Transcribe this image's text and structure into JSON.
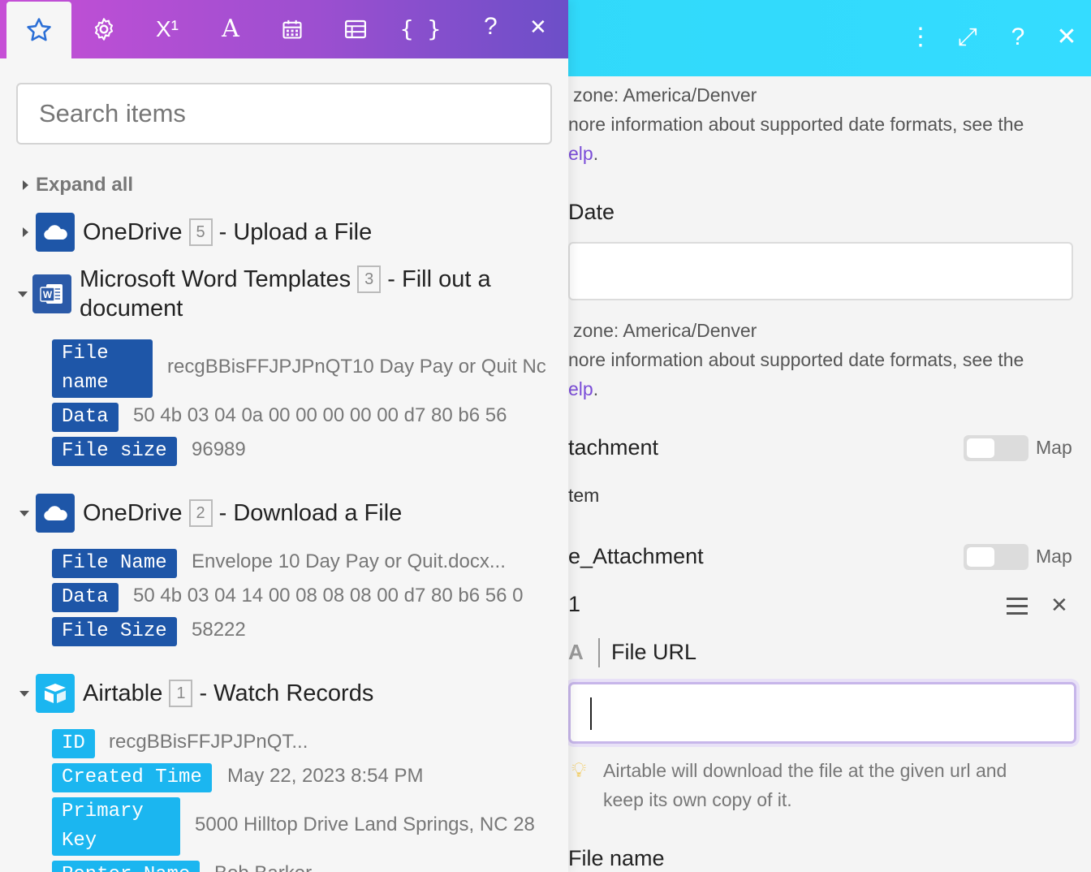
{
  "left_panel": {
    "tabs": [
      {
        "name": "star-icon",
        "glyph": "☆"
      },
      {
        "name": "gear-icon",
        "glyph": "⚙"
      },
      {
        "name": "superscript-icon",
        "glyph": "X¹"
      },
      {
        "name": "text-icon",
        "glyph": "A"
      },
      {
        "name": "calendar-icon",
        "glyph": "▦"
      },
      {
        "name": "table-icon",
        "glyph": "▤"
      },
      {
        "name": "braces-icon",
        "glyph": "{ }"
      }
    ],
    "help_glyph": "?",
    "close_glyph": "✕",
    "search": {
      "placeholder": "Search items"
    },
    "expand_all": "Expand all",
    "modules": [
      {
        "app": "OneDrive",
        "badge": "5",
        "action": "- Upload a File"
      },
      {
        "app": "Microsoft Word Templates",
        "badge": "3",
        "action": "- Fill out a",
        "action_line2": "document",
        "fields": [
          {
            "label_line1": "File",
            "label_line2": "name",
            "value": "recgBBisFFJPJPnQT10 Day Pay or Quit Nc"
          },
          {
            "label": "Data",
            "value": "50 4b 03 04 0a 00 00 00 00 00 d7 80 b6 56"
          },
          {
            "label": "File size",
            "value": "96989"
          }
        ]
      },
      {
        "app": "OneDrive",
        "badge": "2",
        "action": "- Download a File",
        "fields": [
          {
            "label": "File Name",
            "value": "Envelope 10 Day Pay or Quit.docx..."
          },
          {
            "label": "Data",
            "value": "50 4b 03 04 14 00 08 08 08 00 d7 80 b6 56 0"
          },
          {
            "label": "File Size",
            "value": "58222"
          }
        ]
      },
      {
        "app": "Airtable",
        "badge": "1",
        "action": "- Watch Records",
        "fields": [
          {
            "label": "ID",
            "value": "recgBBisFFJPJPnQT..."
          },
          {
            "label": "Created Time",
            "value": "May 22, 2023 8:54 PM"
          },
          {
            "label_line1": "Primary",
            "label_line2": "Key",
            "value": "5000 Hilltop Drive Land Springs, NC 28"
          },
          {
            "label": "Renter Name",
            "value": "Bob Barker"
          }
        ]
      }
    ],
    "colors": {
      "onedrive": "#1e56a8",
      "word": "#2b5aa8",
      "airtable": "#1bb6f0",
      "tab_active": "#2b6fd6"
    }
  },
  "right_panel": {
    "header_icons": [
      {
        "name": "kebab-menu-icon",
        "glyph": "⋮"
      },
      {
        "name": "expand-icon",
        "glyph": "⤢"
      },
      {
        "name": "help-icon",
        "glyph": "?"
      },
      {
        "name": "close-icon",
        "glyph": "✕"
      }
    ],
    "tz_text_1": "zone: America/Denver",
    "more_info_1": "nore information about supported date formats, see the",
    "help_link_1": "elp",
    "date_label": "Date",
    "tz_text_2": "zone: America/Denver",
    "more_info_2": "nore information about supported date formats, see the",
    "help_link_2": "elp",
    "attachment_label": "tachment",
    "map_label_1": "Map",
    "item_text": "tem",
    "type_attachment_label": "e_Attachment",
    "map_label_2": "Map",
    "item1_label": "1",
    "type_glyph": "A",
    "file_url_label": "File URL",
    "hint": "Airtable will download the file at the given url and",
    "hint_line2": "keep its own copy of it.",
    "file_name_label": "File name"
  }
}
